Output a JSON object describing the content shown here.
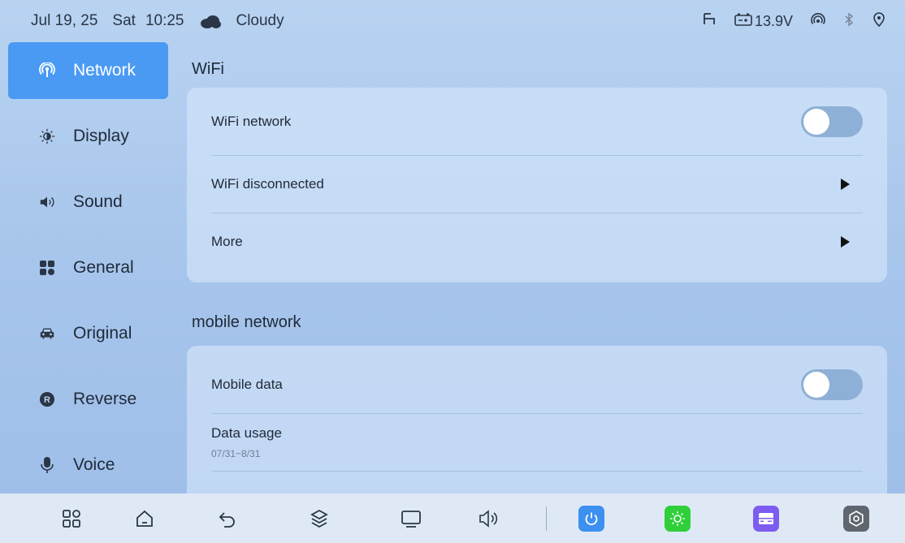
{
  "status": {
    "date": "Jul 19, 25",
    "day": "Sat",
    "time": "10:25",
    "weather_icon": "cloud-icon",
    "weather": "Cloudy",
    "voltage": "13.9V"
  },
  "sidebar": {
    "items": [
      {
        "label": "Network",
        "icon": "network-icon",
        "active": true
      },
      {
        "label": "Display",
        "icon": "brightness-icon"
      },
      {
        "label": "Sound",
        "icon": "speaker-icon"
      },
      {
        "label": "General",
        "icon": "grid-icon"
      },
      {
        "label": "Original",
        "icon": "car-icon"
      },
      {
        "label": "Reverse",
        "icon": "reverse-icon"
      },
      {
        "label": "Voice",
        "icon": "microphone-icon"
      }
    ]
  },
  "wifi": {
    "title": "WiFi",
    "rows": [
      {
        "label": "WiFi network",
        "control": "toggle",
        "on": false
      },
      {
        "label": "WiFi disconnected",
        "control": "arrow"
      },
      {
        "label": "More",
        "control": "arrow"
      }
    ]
  },
  "mobile": {
    "title": "mobile network",
    "rows": [
      {
        "label": "Mobile data",
        "control": "toggle",
        "on": false
      },
      {
        "label": "Data usage",
        "subtext": "07/31~8/31"
      }
    ]
  },
  "dock": {
    "items": [
      "apps-icon",
      "home-icon",
      "back-icon",
      "layers-icon",
      "screen-icon",
      "volume-icon",
      "power-icon",
      "brightness-icon",
      "card-icon",
      "settings-icon"
    ],
    "colors": {
      "power": "#3d8ff0",
      "brightness": "#2fcf3a",
      "card": "#7d5cf0",
      "settings": "#5f6670"
    }
  },
  "colors": {
    "accent": "#4a9af4"
  }
}
